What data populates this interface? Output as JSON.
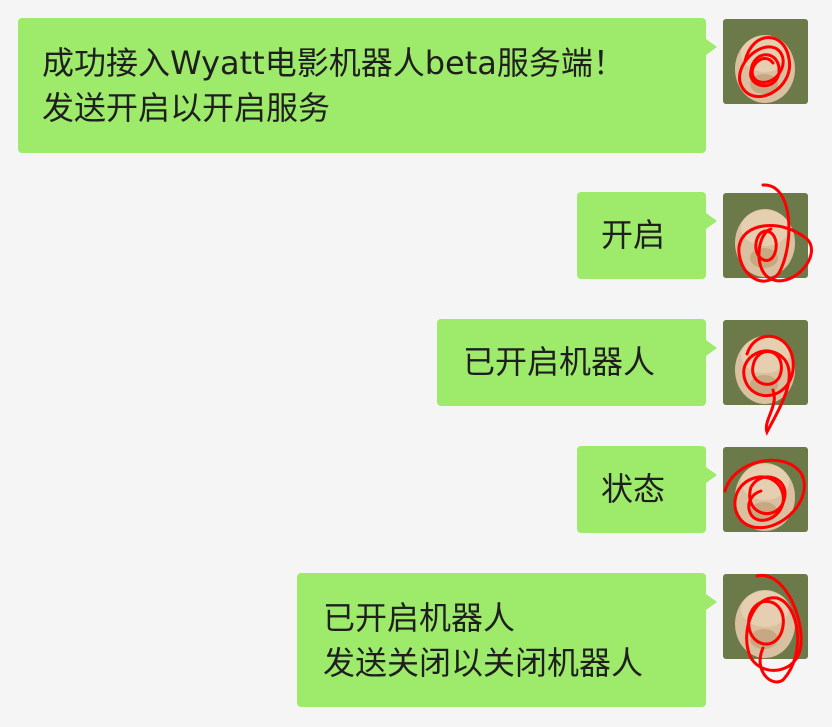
{
  "messages": [
    {
      "sender": "self",
      "lines": [
        "成功接入Wyatt电影机器人beta服务端！",
        "发送开启以开启服务"
      ]
    },
    {
      "sender": "self",
      "lines": [
        "开启"
      ]
    },
    {
      "sender": "self",
      "lines": [
        "已开启机器人"
      ]
    },
    {
      "sender": "self",
      "lines": [
        "状态"
      ]
    },
    {
      "sender": "self",
      "lines": [
        "已开启机器人",
        "发送关闭以关闭机器人"
      ]
    }
  ],
  "avatar": {
    "icon": "dog-avatar-icon",
    "redaction_color": "#ff0000"
  },
  "colors": {
    "background": "#f5f5f5",
    "bubble": "#9eea6a",
    "text": "#1f1f1f"
  }
}
